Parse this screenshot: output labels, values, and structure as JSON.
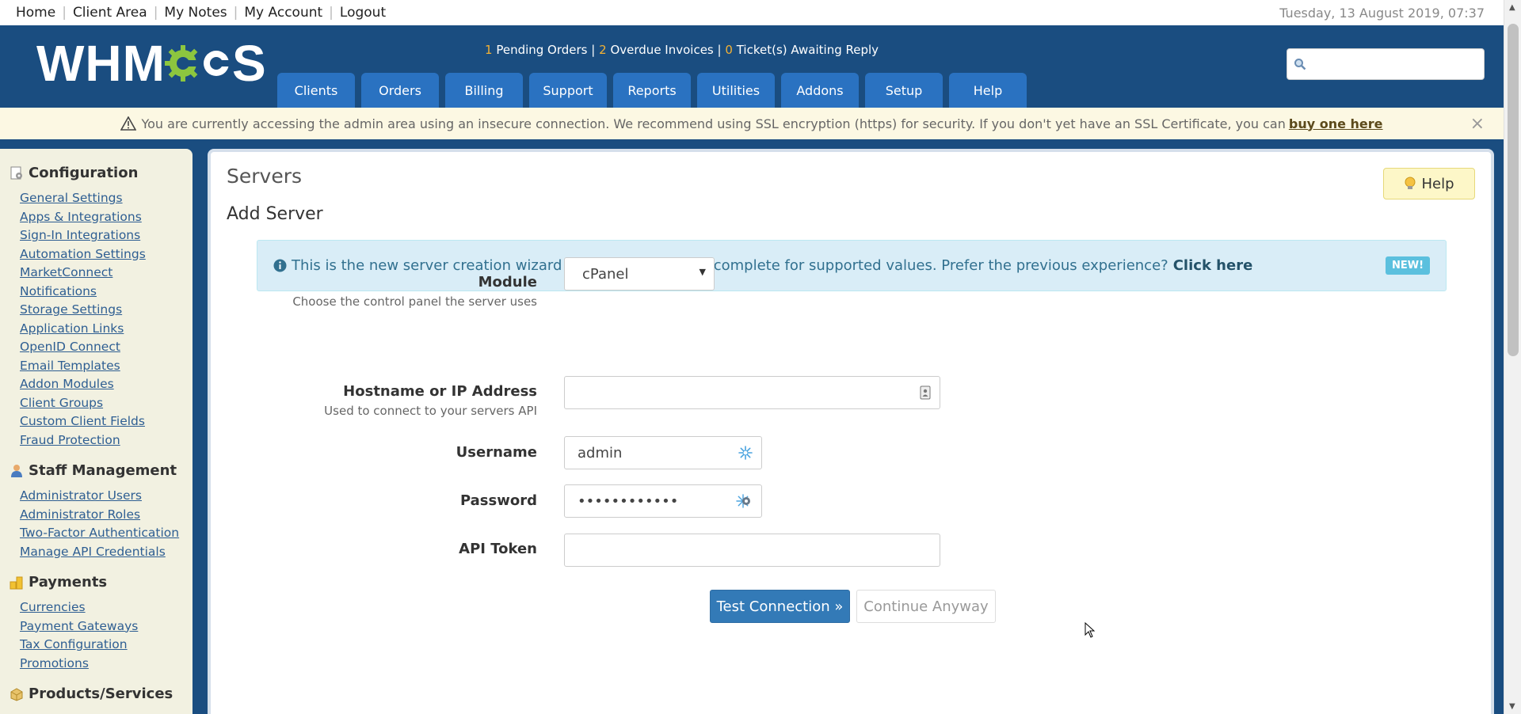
{
  "topbar": {
    "links": [
      "Home",
      "Client Area",
      "My Notes",
      "My Account",
      "Logout"
    ],
    "date": "Tuesday, 13 August 2019, 07:37"
  },
  "header": {
    "logo_text_left": "WHM",
    "logo_text_right": "S",
    "stats": {
      "pending_orders_count": "1",
      "pending_orders_label": "Pending Orders",
      "overdue_invoices_count": "2",
      "overdue_invoices_label": "Overdue Invoices",
      "tickets_count": "0",
      "tickets_label": "Ticket(s) Awaiting Reply",
      "separator": "|"
    },
    "nav": [
      "Clients",
      "Orders",
      "Billing",
      "Support",
      "Reports",
      "Utilities",
      "Addons",
      "Setup",
      "Help"
    ],
    "search_placeholder": ""
  },
  "ssl_warning": {
    "text": "You are currently accessing the admin area using an insecure connection. We recommend using SSL encryption (https) for security. If you don't yet have an SSL Certificate, you can",
    "link": "buy one here",
    "close": "×"
  },
  "sidebar": {
    "groups": [
      {
        "title": "Configuration",
        "icon": "config-icon",
        "items": [
          "General Settings",
          "Apps & Integrations",
          "Sign-In Integrations",
          "Automation Settings",
          "MarketConnect",
          "Notifications",
          "Storage Settings",
          "Application Links",
          "OpenID Connect",
          "Email Templates",
          "Addon Modules",
          "Client Groups",
          "Custom Client Fields",
          "Fraud Protection"
        ]
      },
      {
        "title": "Staff Management",
        "icon": "staff-icon",
        "items": [
          "Administrator Users",
          "Administrator Roles",
          "Two-Factor Authentication",
          "Manage API Credentials"
        ]
      },
      {
        "title": "Payments",
        "icon": "payments-icon",
        "items": [
          "Currencies",
          "Payment Gateways",
          "Tax Configuration",
          "Promotions"
        ]
      },
      {
        "title": "Products/Services",
        "icon": "products-icon",
        "items": []
      }
    ]
  },
  "main": {
    "title": "Servers",
    "help_button": "Help",
    "subtitle": "Add Server",
    "info": {
      "text": "This is the new server creation wizard which features auto-complete for supported values. Prefer the previous experience?",
      "link": "Click here",
      "badge": "NEW!"
    },
    "form": {
      "module_label": "Module",
      "module_help": "Choose the control panel the server uses",
      "module_value": "cPanel",
      "hostname_label": "Hostname or IP Address",
      "hostname_help": "Used to connect to your servers API",
      "hostname_value": "",
      "username_label": "Username",
      "username_value": "admin",
      "password_label": "Password",
      "password_value": "••••••••••••",
      "apitoken_label": "API Token",
      "apitoken_value": ""
    },
    "buttons": {
      "test": "Test Connection »",
      "continue": "Continue Anyway"
    }
  },
  "colors": {
    "header_bg": "#1a4d80",
    "nav_tab": "#2a72c1",
    "accent_yellow": "#f2b134",
    "primary_button": "#337ab7",
    "info_bg": "#d9edf7",
    "sidebar_bg": "#f2f1e1",
    "warning_bg": "#fcf8e3"
  }
}
